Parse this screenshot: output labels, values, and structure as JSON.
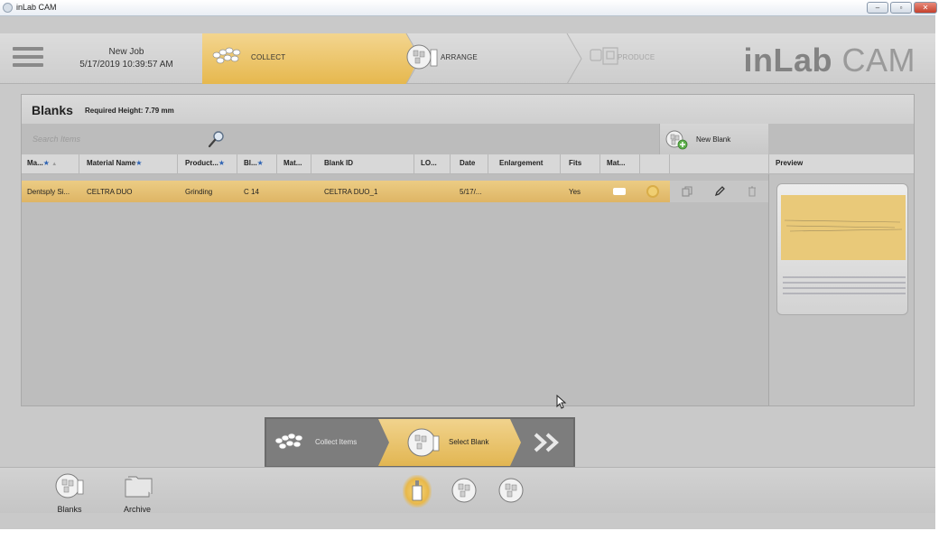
{
  "window": {
    "title": "inLab CAM",
    "min": "–",
    "max": "▫",
    "close": "✕"
  },
  "header": {
    "job_name": "New Job",
    "job_date": "5/17/2019 10:39:57 AM",
    "steps": {
      "collect": "COLLECT",
      "arrange": "ARRANGE",
      "produce": "PRODUCE"
    },
    "brand_bold": "inLab",
    "brand_light": " CAM"
  },
  "blanks": {
    "title": "Blanks",
    "required_height": "Required Height: 7.79 mm",
    "search_placeholder": "Search Items",
    "new_blank": "New Blank",
    "columns": {
      "manufacturer": "Ma...",
      "material_name": "Material Name",
      "product": "Product...",
      "block": "Bl...",
      "mat": "Mat...",
      "blank_id": "Blank ID",
      "lot": "LO...",
      "date": "Date",
      "enlargement": "Enlargement",
      "fits": "Fits",
      "mat2": "Mat...",
      "preview": "Preview"
    },
    "row": {
      "manufacturer": "Dentsply Si...",
      "material_name": "CELTRA DUO",
      "product": "Grinding",
      "block": "C 14",
      "blank_id": "CELTRA DUO_1",
      "date": "5/17/...",
      "fits": "Yes"
    },
    "star": "★"
  },
  "wizard": {
    "collect_items": "Collect Items",
    "select_blank": "Select Blank",
    "next": "»"
  },
  "bottombar": {
    "blanks": "Blanks",
    "archive": "Archive"
  },
  "colors": {
    "accent_gold": "#e6b84e",
    "star_blue": "#2e63b3",
    "background": "#c9c9c9"
  }
}
